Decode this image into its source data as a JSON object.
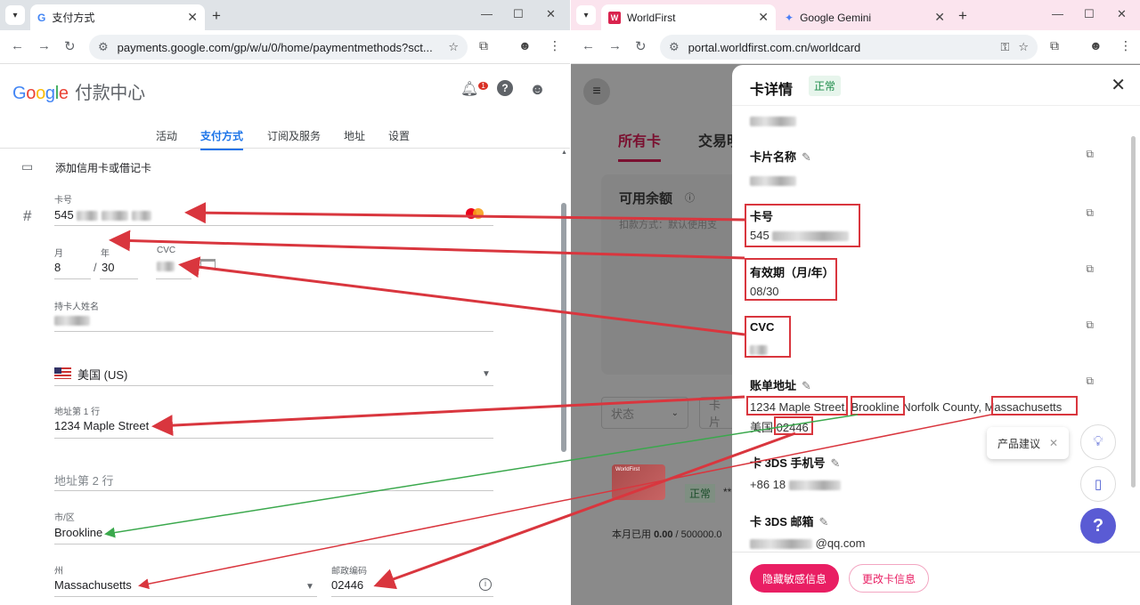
{
  "left_window": {
    "tab_title": "支付方式",
    "url": "payments.google.com/gp/w/u/0/home/paymentmethods?sct...",
    "logo": {
      "letters": [
        "G",
        "o",
        "o",
        "g",
        "l",
        "e"
      ],
      "product": "付款中心"
    },
    "notification_count": "1",
    "nav": [
      "活动",
      "支付方式",
      "订阅及服务",
      "地址",
      "设置"
    ],
    "nav_selected": "支付方式",
    "section_title": "添加信用卡或借记卡",
    "card_number_label": "卡号",
    "card_number_prefix": "545",
    "month_label": "月",
    "year_label": "年",
    "cvc_label": "CVC",
    "month_value": "8",
    "year_value": "30",
    "slash": "/",
    "holder_label": "持卡人姓名",
    "country_value": "美国 (US)",
    "address1_label": "地址第 1 行",
    "address1_value": "1234 Maple Street",
    "address2_placeholder": "地址第 2 行",
    "city_label": "市/区",
    "city_value": "Brookline",
    "state_label": "州",
    "state_value": "Massachusetts",
    "zip_label": "邮政编码",
    "zip_value": "02446"
  },
  "right_window": {
    "tab1_title": "WorldFirst",
    "tab2_title": "Google Gemini",
    "url": "portal.worldfirst.com.cn/worldcard",
    "bg_tabs": [
      "所有卡",
      "交易明"
    ],
    "bg_balance_title": "可用余额",
    "bg_balance_sub": "扣款方式：默认使用支",
    "bg_filter_status": "状态",
    "bg_filter_card": "卡片",
    "bg_card_brand": "WorldFirst",
    "bg_card_status": "正常",
    "bg_card_dots": "**",
    "bg_month_used_label": "本月已用",
    "bg_month_used_value": "0.00",
    "bg_month_limit": "/ 500000.0",
    "panel": {
      "title": "卡详情",
      "status": "正常",
      "card_name_label": "卡片名称",
      "card_number_label": "卡号",
      "card_number_prefix": "545",
      "expiry_label": "有效期（月/年）",
      "expiry_value": "08/30",
      "cvc_label": "CVC",
      "billing_label": "账单地址",
      "addr_street": "1234 Maple Street",
      "addr_city": "Brookline",
      "addr_county": " Norfolk County, ",
      "addr_state": "Massachusetts",
      "addr_country": "美国",
      "addr_zip": "02446",
      "sep": ",",
      "phone_label": "卡 3DS 手机号",
      "phone_prefix": "+86 18",
      "email_label": "卡 3DS 邮箱",
      "email_suffix": "@qq.com",
      "btn_hide": "隐藏敏感信息",
      "btn_change": "更改卡信息"
    },
    "suggestion": "产品建议",
    "help": "?"
  },
  "colors": {
    "accent_google": "#1a73e8",
    "worldfirst_pink": "#e91e63",
    "annotation_red": "#d9363e",
    "annotation_green": "#3aa84c"
  }
}
